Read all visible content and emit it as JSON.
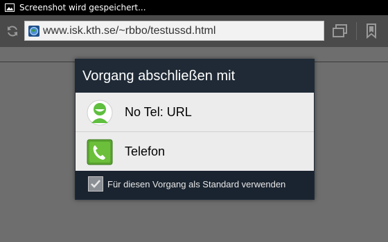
{
  "status_bar": {
    "notification_icon": "picture-icon",
    "text": "Screenshot wird gespeichert..."
  },
  "browser": {
    "url": "www.isk.kth.se/~rbbo/testussd.html",
    "icons": [
      "refresh-icon",
      "globe-icon",
      "tabs-icon",
      "bookmark-icon"
    ]
  },
  "dialog": {
    "title": "Vorgang abschließen mit",
    "options": [
      {
        "label": "No Tel: URL",
        "icon": "android-contact-icon"
      },
      {
        "label": "Telefon",
        "icon": "phone-icon"
      }
    ],
    "default_checkbox": {
      "label": "Für diesen Vorgang als Standard verwenden",
      "checked": true
    }
  },
  "colors": {
    "overlay": "#6e6e6e",
    "dialog_background": "#1f2a36",
    "option_background": "#ececec",
    "phone_green": "#5aa530"
  }
}
